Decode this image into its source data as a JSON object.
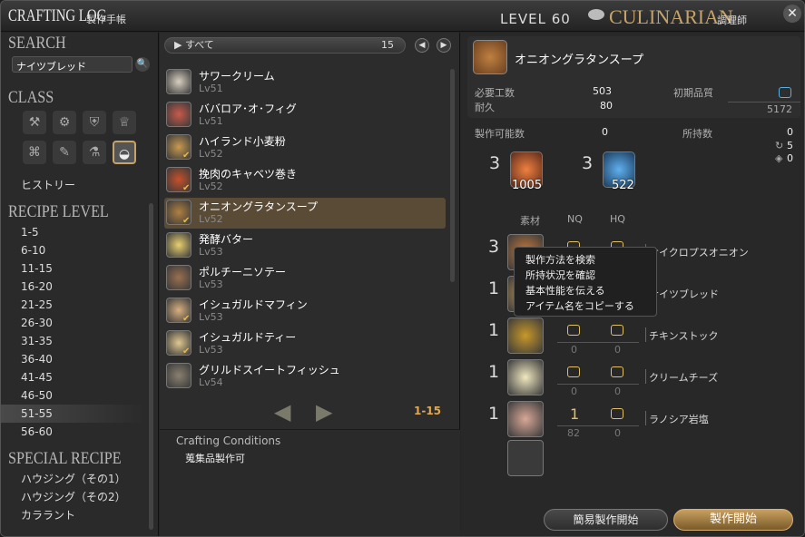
{
  "title": {
    "en": "CRAFTING LOG",
    "jp": "製作手帳",
    "level": "LEVEL 60",
    "job": "CULINARIAN",
    "job_jp": "調理師",
    "close": "✕"
  },
  "search": {
    "heading": "SEARCH",
    "value": "ナイツブレッド",
    "icon": "🔍"
  },
  "class": {
    "heading": "CLASS",
    "history": "ヒストリー"
  },
  "recipe_level": {
    "heading": "RECIPE LEVEL",
    "items": [
      "1-5",
      "6-10",
      "11-15",
      "16-20",
      "21-25",
      "26-30",
      "31-35",
      "36-40",
      "41-45",
      "46-50",
      "51-55",
      "56-60"
    ],
    "selected": "51-55"
  },
  "special": {
    "heading": "SPECIAL RECIPE",
    "items": [
      "ハウジング（その1）",
      "ハウジング（その2）",
      "カララント"
    ]
  },
  "filter": {
    "label": "▶ すべて",
    "count": "15"
  },
  "recipes": [
    {
      "name": "サワークリーム",
      "lv": "Lv51",
      "color": "#d8d0c0"
    },
    {
      "name": "ババロア･オ･フィグ",
      "lv": "Lv51",
      "color": "#c85a4a"
    },
    {
      "name": "ハイランド小麦粉",
      "lv": "Lv52",
      "color": "#c89a50"
    },
    {
      "name": "挽肉のキャベツ巻き",
      "lv": "Lv52",
      "color": "#c8502a"
    },
    {
      "name": "オニオングラタンスープ",
      "lv": "Lv52",
      "color": "#b08040"
    },
    {
      "name": "発酵バター",
      "lv": "Lv53",
      "color": "#e8d070"
    },
    {
      "name": "ポルチーニソテー",
      "lv": "Lv53",
      "color": "#9a7050"
    },
    {
      "name": "イシュガルドマフィン",
      "lv": "Lv53",
      "color": "#d8b080"
    },
    {
      "name": "イシュガルドティー",
      "lv": "Lv53",
      "color": "#e0c890"
    },
    {
      "name": "グリルドスイートフィッシュ",
      "lv": "Lv54",
      "color": "#8a8070"
    }
  ],
  "pager": {
    "prev": "◀",
    "next": "▶",
    "range": "1-15"
  },
  "conditions": {
    "heading": "Crafting Conditions",
    "value": "蒐集品製作可"
  },
  "detail": {
    "name": "オニオングラタンスープ",
    "labels": {
      "work": "必要工数",
      "durability": "耐久",
      "quality": "初期品質",
      "craftable": "製作可能数",
      "owned": "所持数"
    },
    "work": "503",
    "durability": "80",
    "quality_max": "5172",
    "craftable": "0",
    "owned": "0",
    "owned_nq": "5",
    "owned_hq": "0"
  },
  "crystals": [
    {
      "mult": "3",
      "count": "1005",
      "color": "#e05a2a"
    },
    {
      "mult": "3",
      "count": "522",
      "color": "#4a9ae0"
    }
  ],
  "material_headers": {
    "mat": "素材",
    "nq": "NQ",
    "hq": "HQ"
  },
  "materials": [
    {
      "mult": "3",
      "name": "サイクロプスオニオン",
      "nq": "0",
      "hq": "0",
      "sel_nq": "0",
      "color": "#c87a3a"
    },
    {
      "mult": "1",
      "name": "ナイツブレッド",
      "nq": "0",
      "hq": "0",
      "sel_nq": "0",
      "color": "#c89a50"
    },
    {
      "mult": "1",
      "name": "チキンストック",
      "nq": "0",
      "hq": "0",
      "sel_nq": "0",
      "color": "#c8982a"
    },
    {
      "mult": "1",
      "name": "クリームチーズ",
      "nq": "0",
      "hq": "0",
      "sel_nq": "0",
      "color": "#f0e8c0"
    },
    {
      "mult": "1",
      "name": "ラノシア岩塩",
      "nq": "82",
      "hq": "0",
      "sel_nq": "1",
      "color": "#d8a898"
    }
  ],
  "context_menu": [
    "製作方法を検索",
    "所持状況を確認",
    "基本性能を伝える",
    "アイテム名をコピーする"
  ],
  "buttons": {
    "quick": "簡易製作開始",
    "start": "製作開始"
  }
}
